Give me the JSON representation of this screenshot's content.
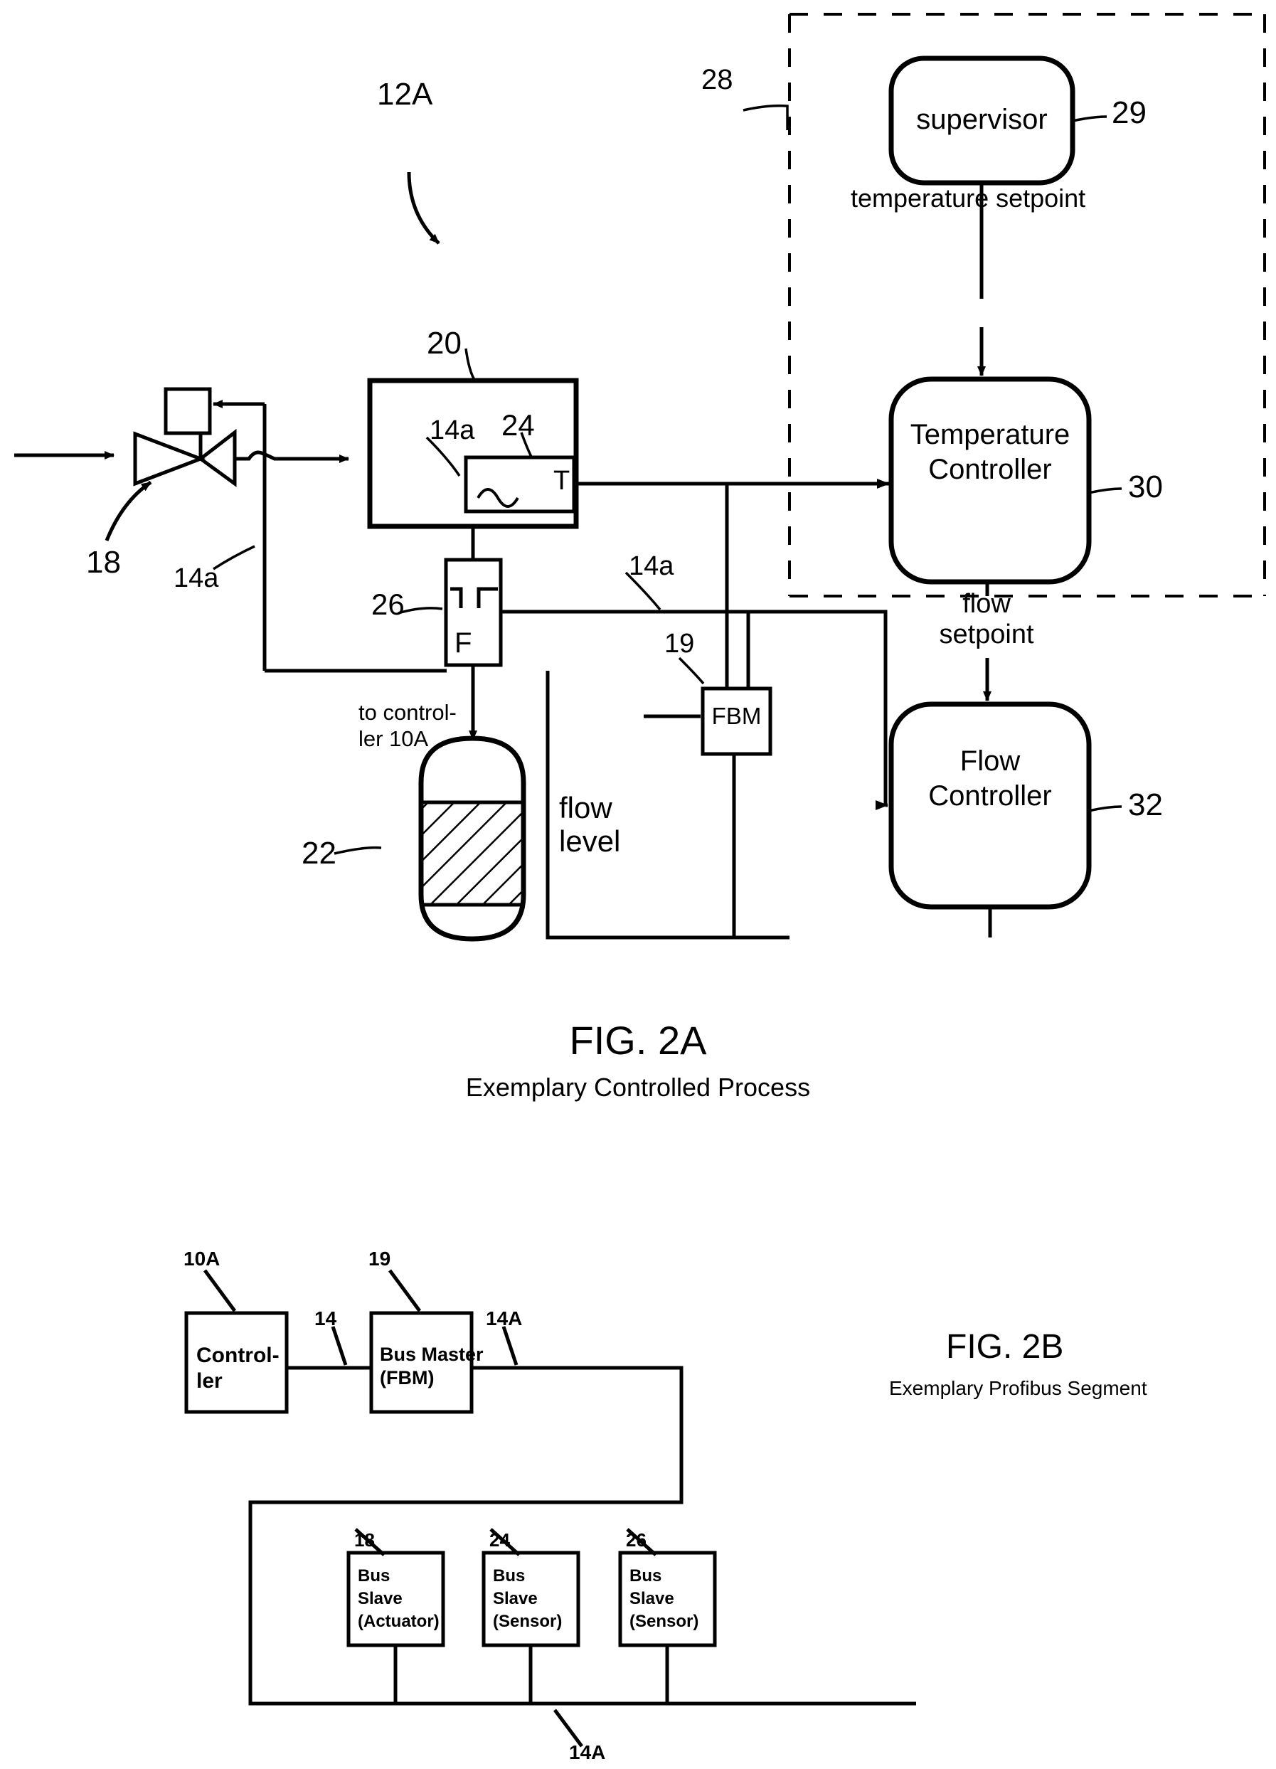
{
  "figures": [
    {
      "id": "fig2a",
      "title": "FIG. 2A",
      "subtitle": "Exemplary Controlled Process",
      "reference_labels": {
        "process": "12A",
        "control_boundary": "28",
        "supervisor": "29",
        "temperature_controller": "30",
        "flow_controller": "32",
        "valve": "18",
        "vessel": "20",
        "tank": "22",
        "temperature_sensor": "24",
        "flow_sensor": "26",
        "fbm": "19",
        "bus_a": "14a",
        "bus_b": "14a",
        "bus_c": "14a"
      },
      "blocks": {
        "supervisor": "supervisor",
        "temperature_controller_line1": "Temperature",
        "temperature_controller_line2": "Controller",
        "flow_controller_line1": "Flow",
        "flow_controller_line2": "Controller",
        "fbm": "FBM",
        "temperature_sensor_symbol": "T",
        "flow_sensor_symbol": "F"
      },
      "annotations": {
        "temperature_setpoint": "temperature setpoint",
        "flow_setpoint_line1": "flow",
        "flow_setpoint_line2": "setpoint",
        "tank_label_line1": "flow",
        "tank_label_line2": "level",
        "to_controller_line1": "to control-",
        "to_controller_line2": "ler 10A"
      }
    },
    {
      "id": "fig2b",
      "title": "FIG. 2B",
      "subtitle": "Exemplary Profibus Segment",
      "reference_labels": {
        "controller": "10A",
        "bus_master": "19",
        "link_14": "14",
        "link_14A_top": "14A",
        "link_14A_bottom": "14A",
        "slave_actuator": "18",
        "slave_sensor_1": "24",
        "slave_sensor_2": "26"
      },
      "blocks": [
        {
          "name": "controller",
          "line1": "Control-",
          "line2": "ler"
        },
        {
          "name": "bus-master",
          "line1": "Bus Master",
          "line2": "(FBM)"
        },
        {
          "name": "bus-slave-actuator",
          "line1": "Bus",
          "line2": "Slave",
          "line3": "(Actuator)"
        },
        {
          "name": "bus-slave-sensor-1",
          "line1": "Bus",
          "line2": "Slave",
          "line3": "(Sensor)"
        },
        {
          "name": "bus-slave-sensor-2",
          "line1": "Bus",
          "line2": "Slave",
          "line3": "(Sensor)"
        }
      ]
    }
  ],
  "colors": {
    "ink": "#000000",
    "paper": "#ffffff"
  }
}
